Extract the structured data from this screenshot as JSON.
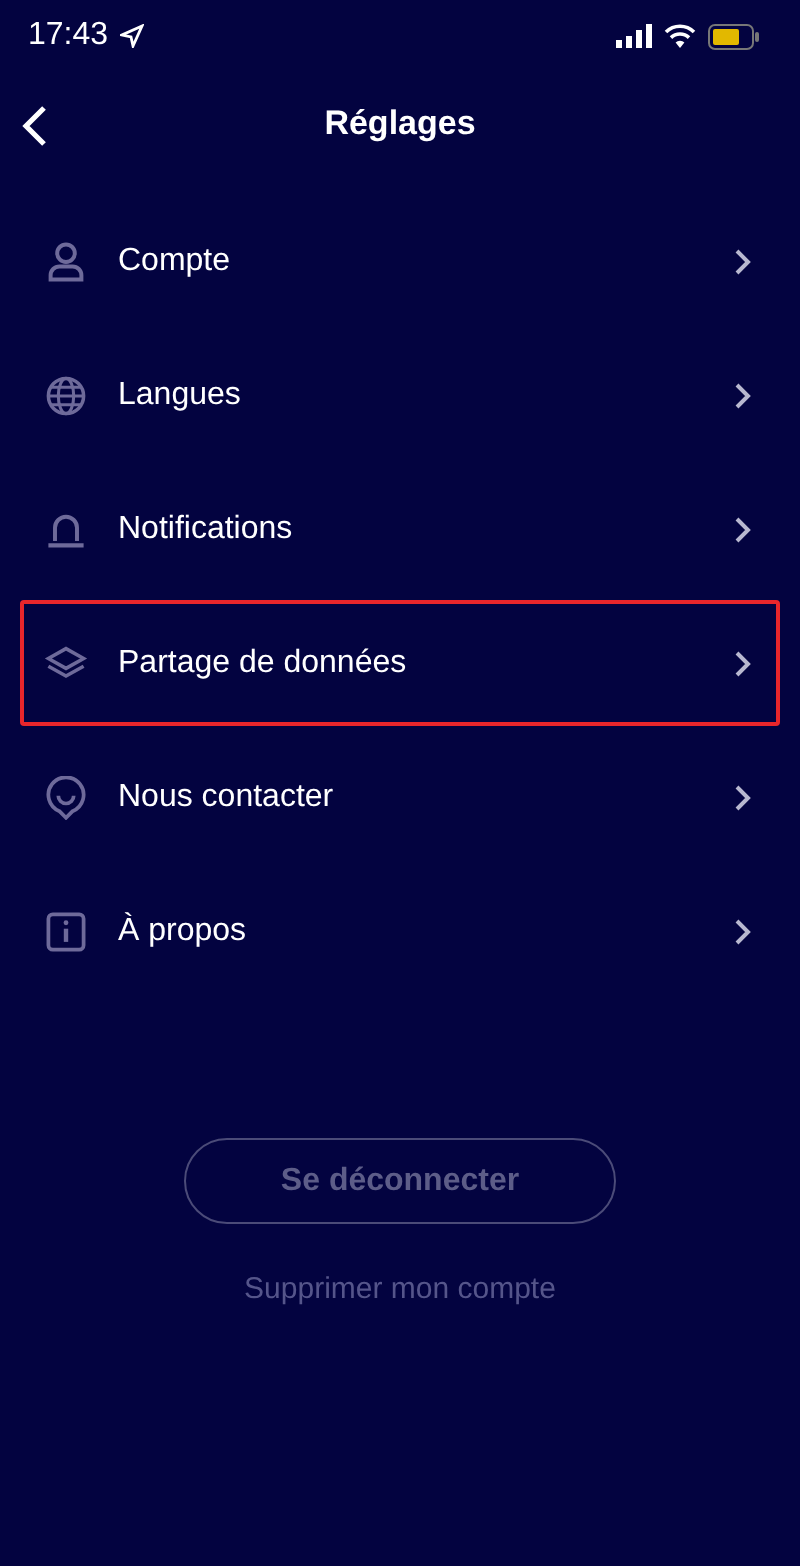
{
  "status_bar": {
    "time": "17:43"
  },
  "header": {
    "title": "Réglages"
  },
  "items": [
    {
      "label": "Compte",
      "highlighted": false
    },
    {
      "label": "Langues",
      "highlighted": false
    },
    {
      "label": "Notifications",
      "highlighted": false
    },
    {
      "label": "Partage de données",
      "highlighted": true
    },
    {
      "label": "Nous contacter",
      "highlighted": false
    },
    {
      "label": "À propos",
      "highlighted": false
    }
  ],
  "logout_button": {
    "label": "Se déconnecter",
    "disabled": true
  },
  "delete_link": {
    "label": "Supprimer mon compte"
  }
}
